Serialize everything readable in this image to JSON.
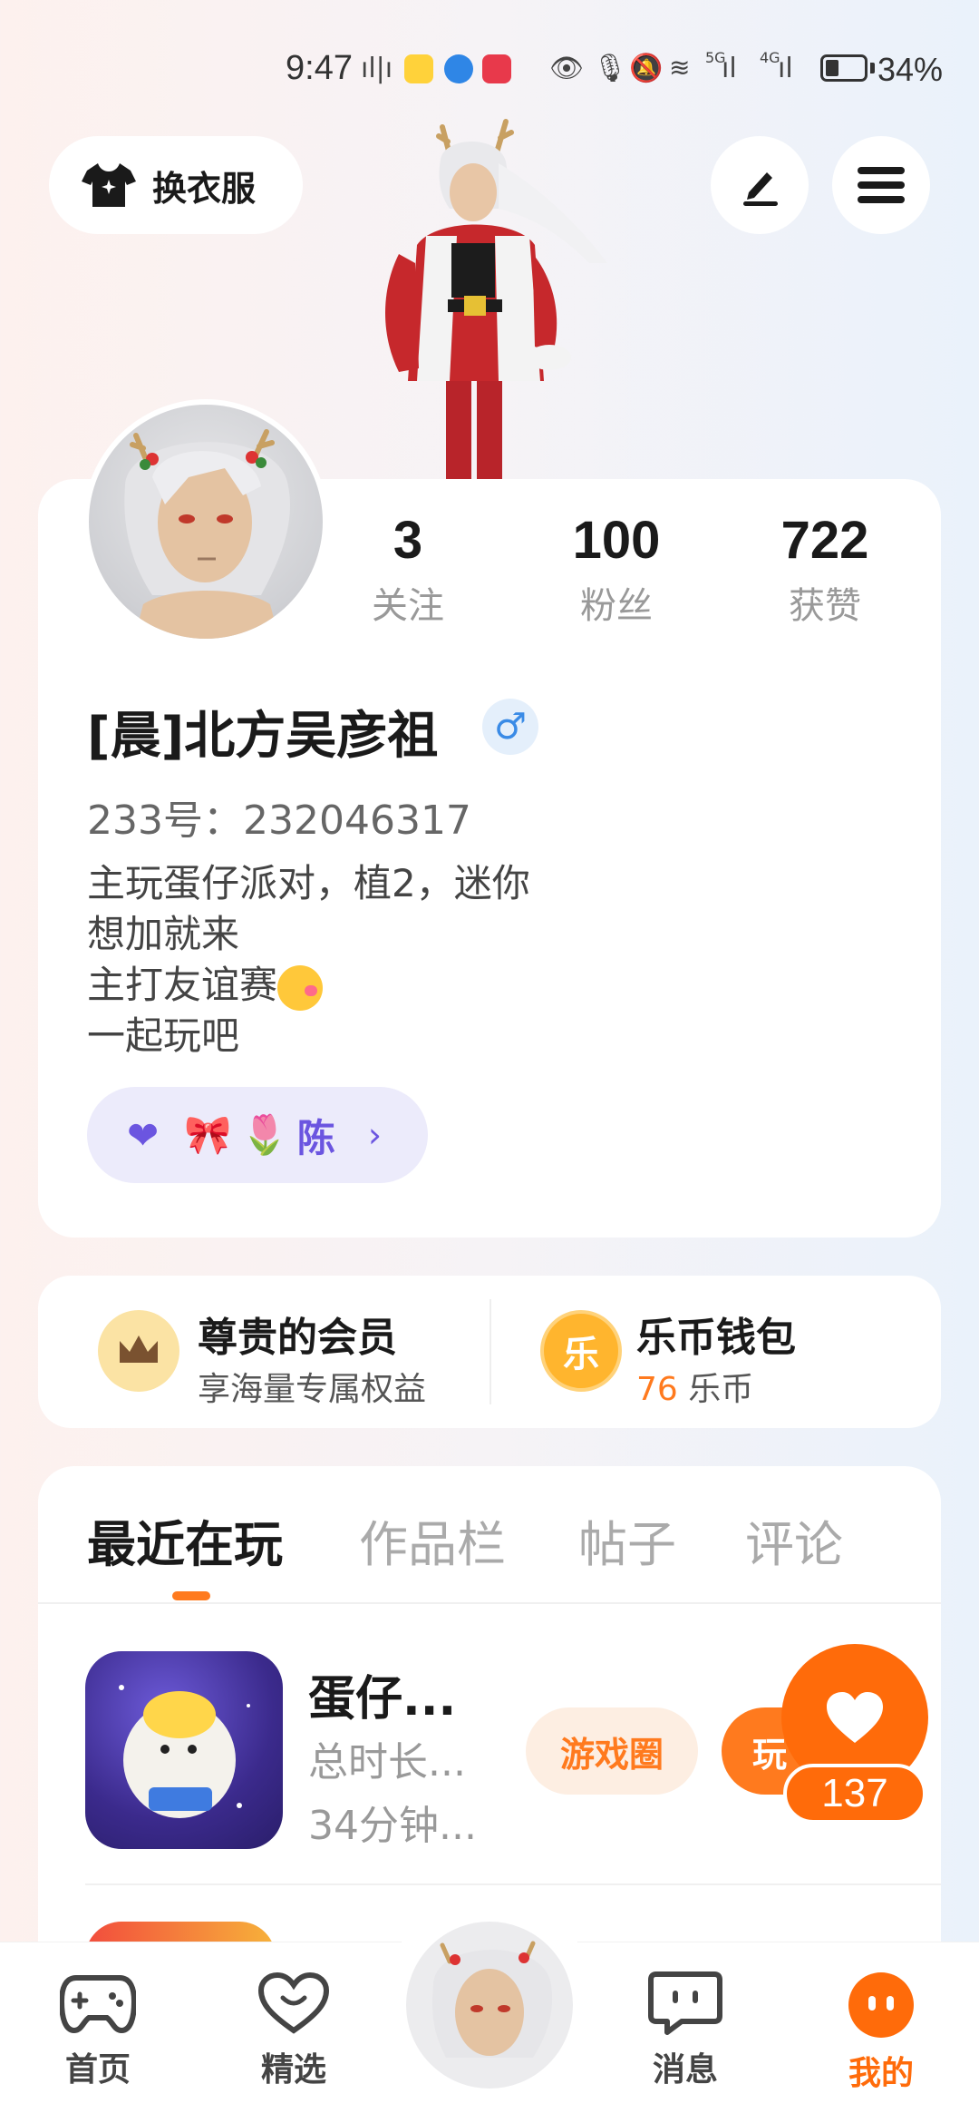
{
  "status_bar": {
    "time": "9:47",
    "network_5g": "5G",
    "network_4g": "4G",
    "battery": "34%"
  },
  "top": {
    "outfit_label": "换衣服"
  },
  "profile": {
    "stats": [
      {
        "value": "3",
        "label": "关注"
      },
      {
        "value": "100",
        "label": "粉丝"
      },
      {
        "value": "722",
        "label": "获赞"
      }
    ],
    "username": "[晨]北方吴彦祖",
    "gender_symbol": "♂",
    "uid": "233号：232046317",
    "bio": [
      "主玩蛋仔派对，植2，迷你",
      "想加就来",
      "主打友谊赛",
      "一起玩吧"
    ],
    "tag_name": "陈"
  },
  "member": {
    "vip_title": "尊贵的会员",
    "vip_sub": "享海量专属权益",
    "wallet_title": "乐币钱包",
    "wallet_amount": "76",
    "wallet_unit": "乐币",
    "wallet_icon_char": "乐"
  },
  "tabs": [
    "最近在玩",
    "作品栏",
    "帖子",
    "评论"
  ],
  "game": {
    "title": "蛋仔...",
    "sub1": "总时长...",
    "sub2": "34分钟...",
    "circle_label": "游戏圈",
    "play_label": "玩"
  },
  "like": {
    "count": "137"
  },
  "nav": [
    {
      "label": "首页",
      "icon": "gamepad-icon"
    },
    {
      "label": "精选",
      "icon": "heart-outline-icon"
    },
    {
      "label": "消息",
      "icon": "chat-icon"
    },
    {
      "label": "我的",
      "icon": "profile-face-icon"
    }
  ],
  "colors": {
    "accent": "#ff7a1e",
    "purple": "#6b55e0"
  }
}
